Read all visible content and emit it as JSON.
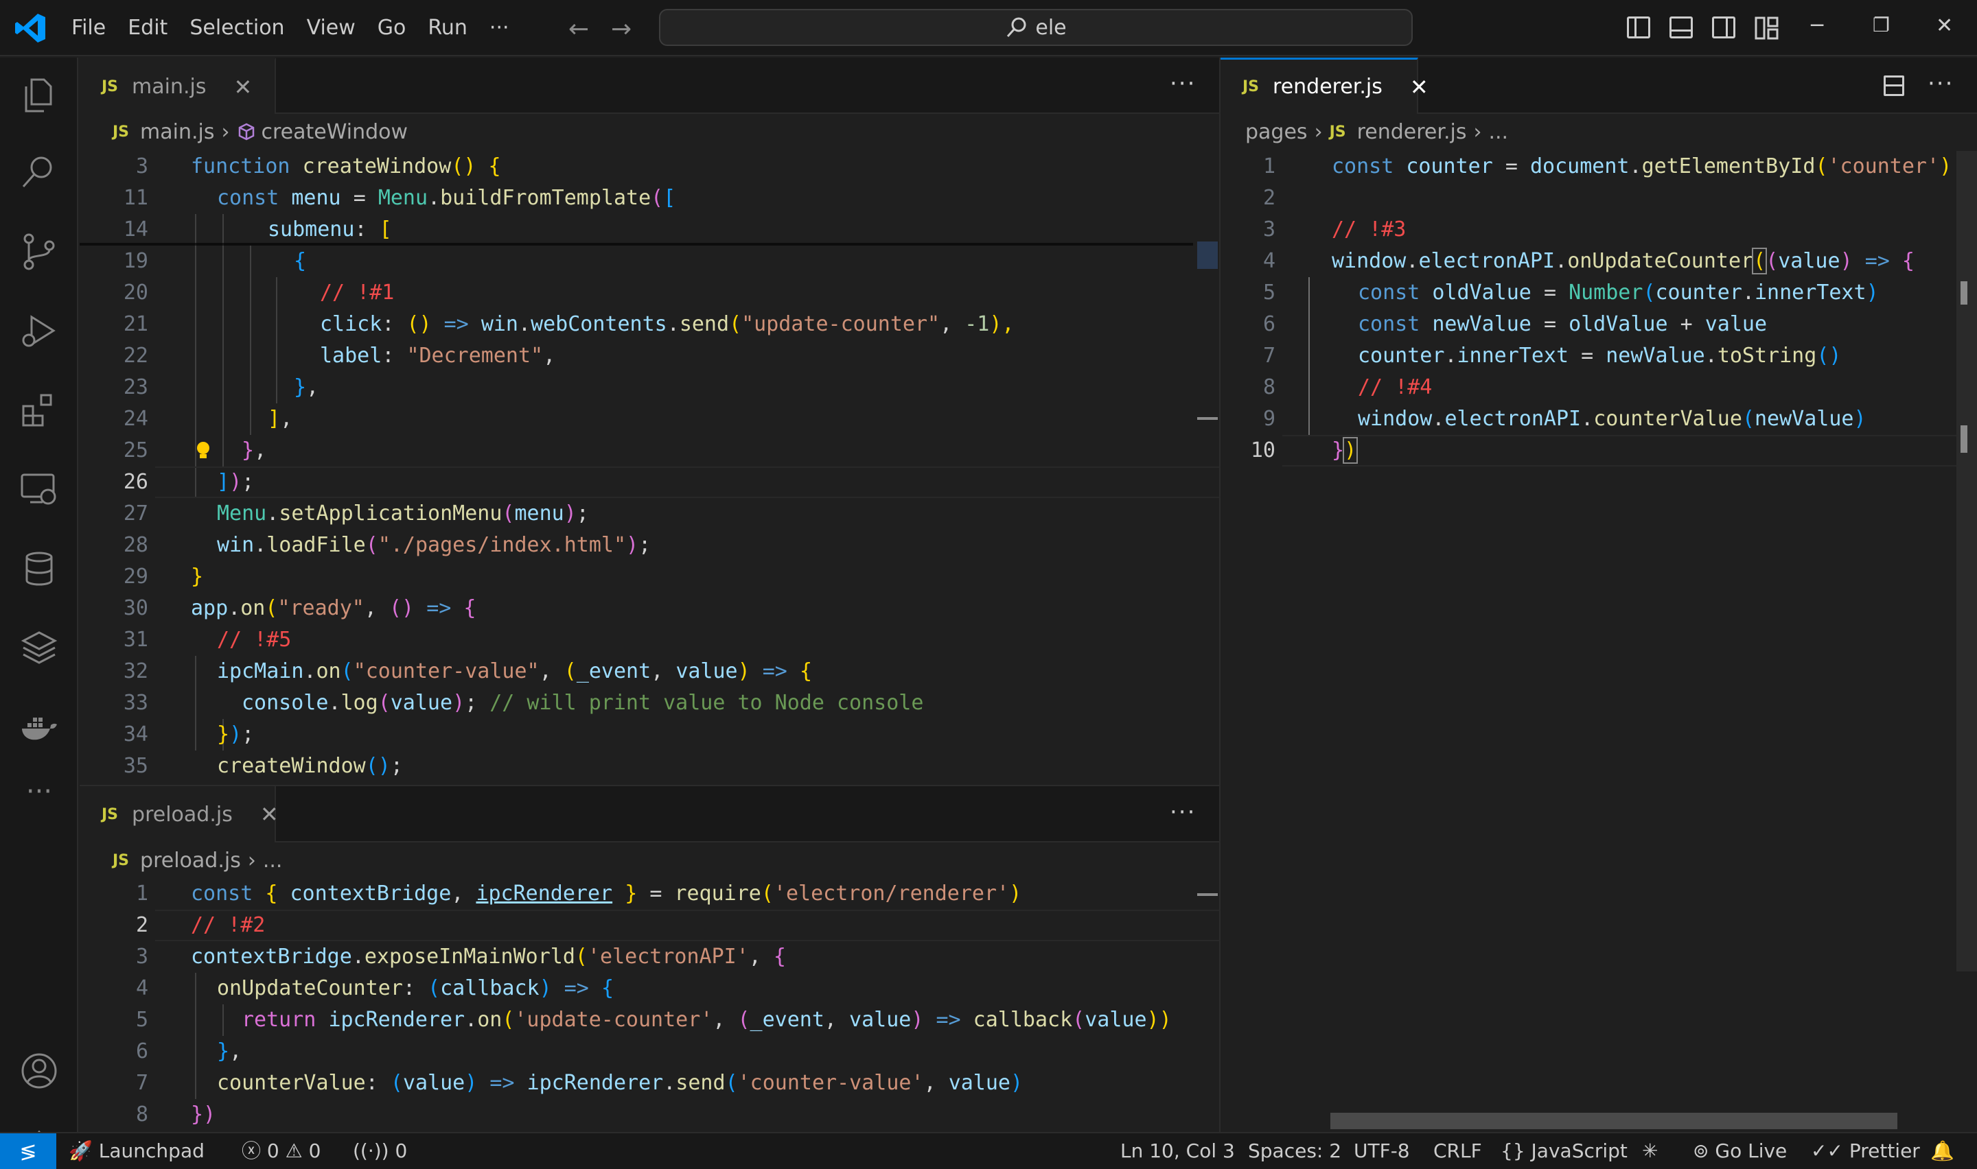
{
  "menu": {
    "file": "File",
    "edit": "Edit",
    "selection": "Selection",
    "view": "View",
    "go": "Go",
    "run": "Run",
    "more": "···"
  },
  "search": {
    "text": "ele"
  },
  "left_top": {
    "tab": {
      "badge": "JS",
      "label": "main.js"
    },
    "breadcrumb": {
      "file": "main.js",
      "symbol": "createWindow"
    }
  },
  "left_bottom": {
    "tab": {
      "badge": "JS",
      "label": "preload.js"
    },
    "breadcrumb": {
      "file": "preload.js",
      "more": "..."
    }
  },
  "right": {
    "tab": {
      "badge": "JS",
      "label": "renderer.js"
    },
    "breadcrumb": {
      "folder": "pages",
      "file": "renderer.js",
      "more": "..."
    }
  },
  "line_numbers": {
    "main": [
      "3",
      "11",
      "14",
      "19",
      "20",
      "21",
      "22",
      "23",
      "24",
      "25",
      "26",
      "27",
      "28",
      "29",
      "30",
      "31",
      "32",
      "33",
      "34",
      "35"
    ],
    "preload": [
      "1",
      "2",
      "3",
      "4",
      "5",
      "6",
      "7",
      "8"
    ],
    "renderer": [
      "1",
      "2",
      "3",
      "4",
      "5",
      "6",
      "7",
      "8",
      "9",
      "10"
    ]
  },
  "main_code": {
    "l3": [
      "function",
      "createWindow",
      "()",
      "{"
    ],
    "l11": [
      "const",
      "menu",
      "=",
      "Menu",
      ".",
      "buildFromTemplate",
      "(",
      "["
    ],
    "l14": [
      "submenu",
      ":",
      "["
    ],
    "l19": [
      "{"
    ],
    "l20": [
      "// !#1"
    ],
    "l21": [
      "click",
      ":",
      "()",
      "=>",
      "win",
      ".",
      "webContents",
      ".",
      "send",
      "(",
      "\"update-counter\"",
      ",",
      "-1",
      "),"
    ],
    "l22": [
      "label",
      ":",
      "\"Decrement\"",
      ","
    ],
    "l23": [
      "}",
      ","
    ],
    "l24": [
      "]",
      ","
    ],
    "l25": [
      "}",
      ","
    ],
    "l26": [
      "]",
      ")",
      ";"
    ],
    "l27": [
      "Menu",
      ".",
      "setApplicationMenu",
      "(",
      "menu",
      ")",
      ";"
    ],
    "l28": [
      "win",
      ".",
      "loadFile",
      "(",
      "\"./pages/index.html\"",
      ")",
      ";"
    ],
    "l29": [
      "}"
    ],
    "l30": [
      "app",
      ".",
      "on",
      "(",
      "\"ready\"",
      ",",
      "()",
      "=>",
      "{"
    ],
    "l31": [
      "// !#5"
    ],
    "l32": [
      "ipcMain",
      ".",
      "on",
      "(",
      "\"counter-value\"",
      ",",
      "(",
      "_event",
      ",",
      "value",
      ")",
      "=>",
      "{"
    ],
    "l33": [
      "console",
      ".",
      "log",
      "(",
      "value",
      ")",
      ";",
      "// will print value to Node console"
    ],
    "l34": [
      "}",
      ")",
      ";"
    ],
    "l35": [
      "createWindow",
      "()",
      ";"
    ]
  },
  "preload_code": {
    "l1": [
      "const",
      "{",
      "contextBridge",
      ",",
      "ipcRenderer",
      "}",
      "=",
      "require",
      "(",
      "'electron/renderer'",
      ")"
    ],
    "l2": [
      "// !#2"
    ],
    "l3": [
      "contextBridge",
      ".",
      "exposeInMainWorld",
      "(",
      "'electronAPI'",
      ",",
      "{"
    ],
    "l4": [
      "onUpdateCounter",
      ":",
      "(",
      "callback",
      ")",
      "=>",
      "{"
    ],
    "l5": [
      "return",
      "ipcRenderer",
      ".",
      "on",
      "(",
      "'update-counter'",
      ",",
      "(",
      "_event",
      ",",
      "value",
      ")",
      "=>",
      "callback",
      "(",
      "value",
      "))"
    ],
    "l6": [
      "}",
      ","
    ],
    "l7": [
      "counterValue",
      ":",
      "(",
      "value",
      ")",
      "=>",
      "ipcRenderer",
      ".",
      "send",
      "(",
      "'counter-value'",
      ",",
      "value",
      ")"
    ],
    "l8": [
      "})"
    ]
  },
  "renderer_code": {
    "l1": [
      "const",
      "counter",
      "=",
      "document",
      ".",
      "getElementById",
      "(",
      "'counter'",
      ")"
    ],
    "l3": [
      "// !#3"
    ],
    "l4": [
      "window",
      ".",
      "electronAPI",
      ".",
      "onUpdateCounter",
      "(",
      "(",
      "value",
      ")",
      "=>",
      "{"
    ],
    "l5": [
      "const",
      "oldValue",
      "=",
      "Number",
      "(",
      "counter",
      ".",
      "innerText",
      ")"
    ],
    "l6": [
      "const",
      "newValue",
      "=",
      "oldValue",
      "+",
      "value"
    ],
    "l7": [
      "counter",
      ".",
      "innerText",
      "=",
      "newValue",
      ".",
      "toString",
      "()"
    ],
    "l8": [
      "// !#4"
    ],
    "l9": [
      "window",
      ".",
      "electronAPI",
      ".",
      "counterValue",
      "(",
      "newValue",
      ")"
    ],
    "l10": [
      "}",
      ")"
    ]
  },
  "status": {
    "launchpad": "Launchpad",
    "errors": "0",
    "warnings": "0",
    "ports": "0",
    "position": "Ln 10, Col 3",
    "spaces": "Spaces: 2",
    "encoding": "UTF-8",
    "eol": "CRLF",
    "language": "JavaScript",
    "golive": "Go Live",
    "prettier": "Prettier"
  },
  "colors": {
    "accent": "#0078d4",
    "keyword": "#569cd6",
    "function": "#dcdcaa",
    "string": "#ce9178",
    "comment": "#6a9955",
    "todo": "#f14c4c"
  }
}
